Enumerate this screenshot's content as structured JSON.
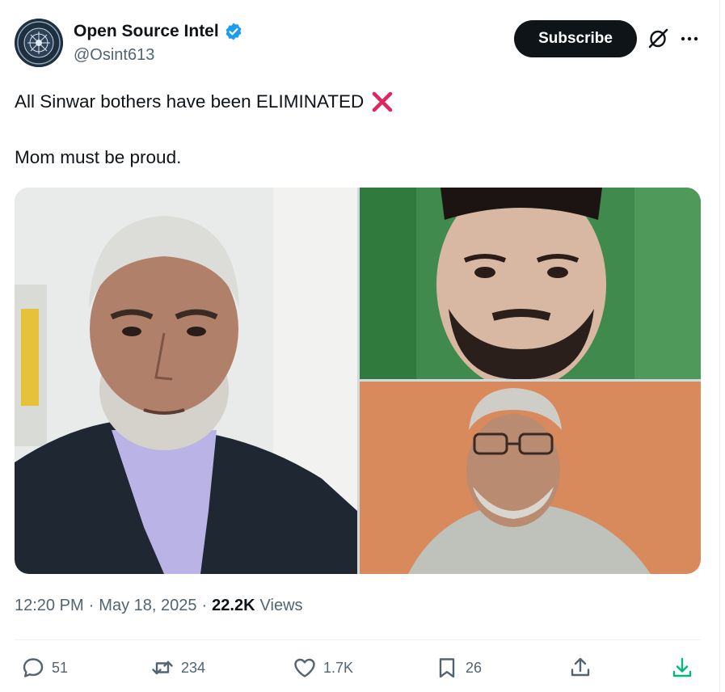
{
  "author": {
    "display_name": "Open Source Intel",
    "handle": "@Osint613",
    "verified_icon": "verified-badge-icon"
  },
  "header": {
    "subscribe_label": "Subscribe"
  },
  "tweet": {
    "line1": "All Sinwar bothers have been ELIMINATED",
    "line1_emoji": "cross-mark-icon",
    "line2": "Mom must be proud."
  },
  "meta": {
    "time": "12:20 PM",
    "sep1": "·",
    "date": "May 18, 2025",
    "sep2": "·",
    "views_count": "22.2K",
    "views_label": "Views"
  },
  "actions": {
    "replies": "51",
    "reposts": "234",
    "likes": "1.7K",
    "bookmarks": "26"
  },
  "colors": {
    "text": "#0f1419",
    "secondary": "#536471",
    "verified": "#1d9bf0",
    "subscribe_bg": "#0f1419",
    "cross": "#e0245e",
    "download": "#00ba7c"
  }
}
